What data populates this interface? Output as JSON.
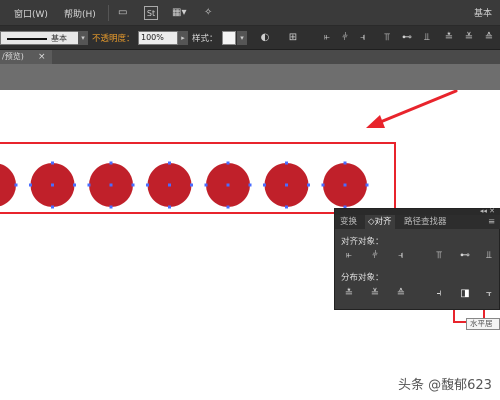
{
  "menubar": {
    "items": [
      "窗口(W)",
      "帮助(H)"
    ],
    "ws_badge": "St",
    "right_label": "基本"
  },
  "control": {
    "stroke_label": "基本",
    "opacity_label": "不透明度：",
    "opacity_value": "100%",
    "style_label": "样式："
  },
  "document_tab": {
    "label": "/预览)",
    "close": "×"
  },
  "canvas": {
    "circle_count": 7,
    "circle_color": "#c0202a",
    "anchor_color": "#4a6cff",
    "highlight_color": "#e8242c"
  },
  "align_panel": {
    "tabs": [
      "变换",
      "◇对齐",
      "路径查找器"
    ],
    "align_objects_label": "对齐对象：",
    "distribute_objects_label": "分布对象："
  },
  "tooltip": {
    "text": "水平居中分布"
  },
  "watermark": "头条 @馥郁623"
}
